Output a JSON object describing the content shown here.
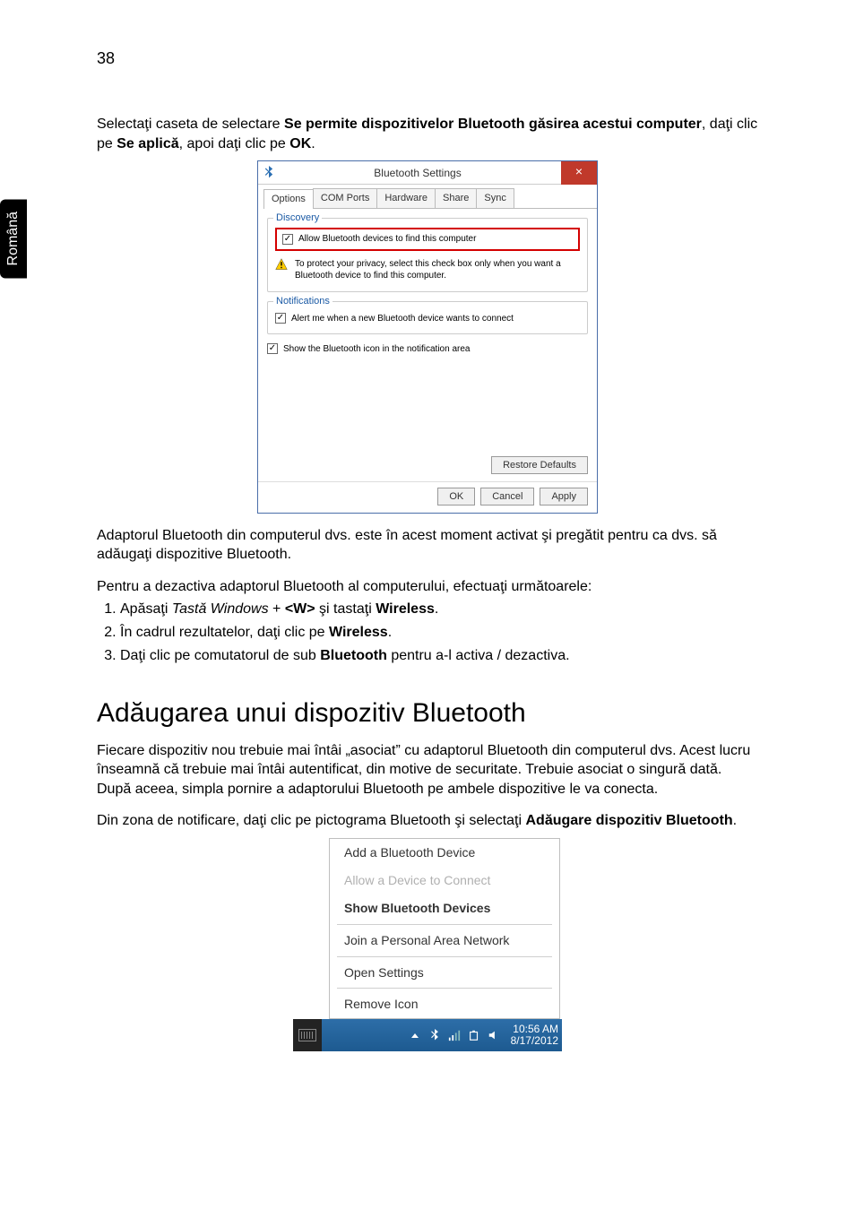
{
  "page_number": "38",
  "side_tab": "Română",
  "body": {
    "p1_a": "Selectaţi caseta de selectare ",
    "p1_b": "Se permite dispozitivelor Bluetooth găsirea acestui computer",
    "p1_c": ", daţi clic pe ",
    "p1_d": "Se aplică",
    "p1_e": ", apoi daţi clic pe ",
    "p1_f": "OK",
    "p1_g": ".",
    "p2": "Adaptorul Bluetooth din computerul dvs. este în acest moment activat şi pregătit pentru ca dvs. să adăugaţi dispozitive Bluetooth.",
    "p3": "Pentru a dezactiva adaptorul Bluetooth al computerului, efectuaţi următoarele:",
    "step1_a": "Apăsaţi ",
    "step1_b": "Tastă Windows",
    "step1_c": " + ",
    "step1_d": "<W>",
    "step1_e": " şi tastaţi ",
    "step1_f": "Wireless",
    "step1_g": ".",
    "step2_a": "În cadrul rezultatelor, daţi clic pe ",
    "step2_b": "Wireless",
    "step2_c": ".",
    "step3_a": "Daţi clic pe comutatorul de sub ",
    "step3_b": "Bluetooth",
    "step3_c": " pentru a-l activa / dezactiva.",
    "h2": "Adăugarea unui dispozitiv Bluetooth",
    "p4": "Fiecare dispozitiv nou trebuie mai întâi „asociat” cu adaptorul Bluetooth din computerul dvs. Acest lucru înseamnă că trebuie mai întâi autentificat, din motive de securitate. Trebuie asociat o singură dată. După aceea, simpla pornire a adaptorului Bluetooth pe ambele dispozitive le va conecta.",
    "p5_a": "Din zona de notificare, daţi clic pe pictograma Bluetooth şi selectaţi ",
    "p5_b": "Adăugare dispozitiv Bluetooth",
    "p5_c": "."
  },
  "dialog": {
    "title": "Bluetooth Settings",
    "tabs": {
      "options": "Options",
      "com": "COM Ports",
      "hw": "Hardware",
      "share": "Share",
      "sync": "Sync"
    },
    "discovery_legend": "Discovery",
    "allow_find": "Allow Bluetooth devices to find this computer",
    "warn": "To protect your privacy, select this check box only when you want a Bluetooth device to find this computer.",
    "notify_legend": "Notifications",
    "notify_chk": "Alert me when a new Bluetooth device wants to connect",
    "show_icon": "Show the Bluetooth icon in the notification area",
    "restore": "Restore Defaults",
    "ok": "OK",
    "cancel": "Cancel",
    "apply": "Apply"
  },
  "context_menu": {
    "add": "Add a Bluetooth Device",
    "allow": "Allow a Device to Connect",
    "show": "Show Bluetooth Devices",
    "join": "Join a Personal Area Network",
    "open": "Open Settings",
    "remove": "Remove Icon",
    "time": "10:56 AM",
    "date": "8/17/2012"
  }
}
